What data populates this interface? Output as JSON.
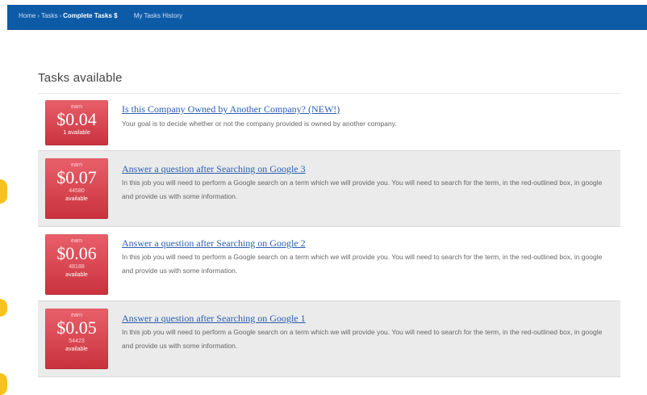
{
  "nav": {
    "crumb_home": "Home",
    "crumb_tasks": "Tasks",
    "crumb_current": "Complete Tasks $",
    "history": "My Tasks History"
  },
  "section": {
    "heading": "Tasks available"
  },
  "tasks": [
    {
      "earn": "earn",
      "amount": "$0.04",
      "count": "",
      "available": "1 available",
      "title": "Is this Company Owned by Another Company? (NEW!)",
      "description": "Your goal is to decide whether or not the company provided is owned by another company."
    },
    {
      "earn": "earn",
      "amount": "$0.07",
      "count": "44580",
      "available": "available",
      "title": "Answer a question after Searching on Google 3",
      "description": "In this job you will need to perform a Google search on a term which we will provide you. You will need to search for the term, in the red-outlined box, in google and provide us with some information."
    },
    {
      "earn": "earn",
      "amount": "$0.06",
      "count": "48188",
      "available": "available",
      "title": "Answer a question after Searching on Google 2",
      "description": "In this job you will need to perform a Google search on a term which we will provide you. You will need to search for the term, in the red-outlined box, in google and provide us with some information."
    },
    {
      "earn": "earn",
      "amount": "$0.05",
      "count": "54423",
      "available": "available",
      "title": "Answer a question after Searching on Google 1",
      "description": "In this job you will need to perform a Google search on a term which we will provide you. You will need to search for the term, in the red-outlined box, in google and provide us with some information."
    }
  ],
  "colors": {
    "topbar": "#0d5aa7",
    "badge": "#d9444f",
    "link": "#2a5db0",
    "row_alt": "#ebebeb"
  }
}
